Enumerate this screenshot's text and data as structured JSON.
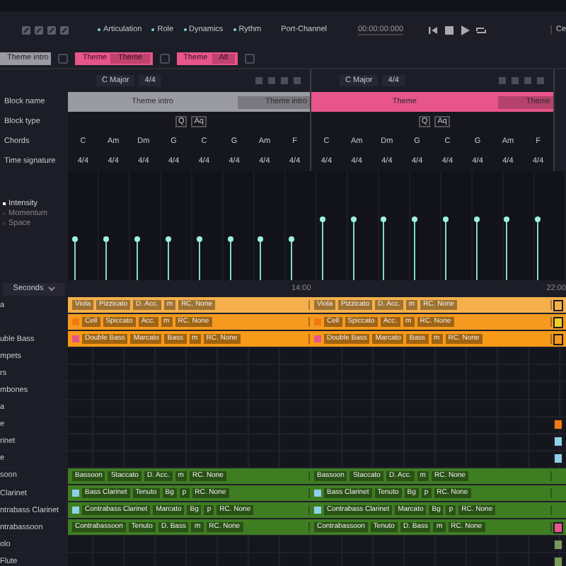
{
  "toolbar": {
    "legend": [
      {
        "label": "Articulation"
      },
      {
        "label": "Role"
      },
      {
        "label": "Dynamics"
      },
      {
        "label": "Rythm"
      }
    ],
    "port": "Port-Channel",
    "time": "00:00:00:000",
    "cut_label": "Ce"
  },
  "palette": [
    {
      "label": "Theme intro",
      "color": "#9a9aa2"
    },
    {
      "label": "Theme",
      "tag": "Theme",
      "color": "#e8558a"
    },
    {
      "label": "Theme",
      "tag": "Alt",
      "color": "#e8558a"
    }
  ],
  "row_labels": [
    "Block name",
    "Block type",
    "Chords",
    "Time signature"
  ],
  "blocks": [
    {
      "key": "C Major",
      "meter": "4/4",
      "name": "Theme intro",
      "tag": "Theme intro",
      "color": "#9a9aa2",
      "types": [
        "Q",
        "Aq"
      ],
      "chords": [
        "C",
        "Am",
        "Dm",
        "G",
        "C",
        "G",
        "Am",
        "F"
      ],
      "signatures": [
        "4/4",
        "4/4",
        "4/4",
        "4/4",
        "4/4",
        "4/4",
        "4/4",
        "4/4"
      ]
    },
    {
      "key": "C Major",
      "meter": "4/4",
      "name": "Theme",
      "tag": "Theme",
      "color": "#e8558a",
      "types": [
        "Q",
        "Aq"
      ],
      "chords": [
        "C",
        "Am",
        "Dm",
        "G",
        "C",
        "G",
        "Am",
        "F"
      ],
      "signatures": [
        "4/4",
        "4/4",
        "4/4",
        "4/4",
        "4/4",
        "4/4",
        "4/4",
        "4/4"
      ]
    }
  ],
  "curves": [
    {
      "label": "Intensity",
      "selected": true
    },
    {
      "label": "Momentum",
      "selected": false
    },
    {
      "label": "Space",
      "selected": false
    }
  ],
  "timeline": {
    "unit": "Seconds",
    "marks": [
      "14:00",
      "22:00"
    ]
  },
  "tracks": [
    {
      "label": "a",
      "color": "#f5b04c",
      "clips": [
        [
          "Viola",
          "Pizzicato",
          "D. Acc.",
          "m",
          "RC. None"
        ],
        [
          "Viola",
          "Pizzicato",
          "D. Acc.",
          "m",
          "RC. None"
        ]
      ],
      "edge": {
        "color": "#f5b04c"
      }
    },
    {
      "color": "#f59a1f",
      "marker": {
        "color": "#f07a10"
      },
      "clips": [
        [
          "Cell",
          "Spiccato",
          "Acc.",
          "m",
          "RC. None"
        ],
        [
          "Cell",
          "Spiccato",
          "Acc.",
          "m",
          "RC. None"
        ]
      ],
      "edge": {
        "color": "#f0d020"
      }
    },
    {
      "label": "uble Bass",
      "color": "#f79a18",
      "marker": {
        "color": "#e8558a"
      },
      "clips": [
        [
          "Double Bass",
          "Marcato",
          "Bass",
          "m",
          "RC. None"
        ],
        [
          "Double Bass",
          "Marcato",
          "Bass",
          "m",
          "RC. None"
        ]
      ],
      "edge": {
        "color": "#f79a18"
      }
    },
    {
      "label": "mpets"
    },
    {
      "label": "rs"
    },
    {
      "label": "mbones"
    },
    {
      "label": "a"
    },
    {
      "label": "e",
      "edge": {
        "color": "#f07a10"
      }
    },
    {
      "label": "rinet",
      "edge": {
        "color": "#8fd0e8"
      }
    },
    {
      "label": "e",
      "edge": {
        "color": "#8fd0e8"
      }
    },
    {
      "label": "soon",
      "color": "#3f7d22",
      "clips": [
        [
          "Bassoon",
          "Staccato",
          "D. Acc.",
          "m",
          "RC. None"
        ],
        [
          "Bassoon",
          "Staccato",
          "D. Acc.",
          "m",
          "RC. None"
        ]
      ]
    },
    {
      "label": "Clarinet",
      "color": "#3f7d22",
      "marker": {
        "color": "#8fd0e8"
      },
      "clips": [
        [
          "Bass Clarinet",
          "Tenuto",
          "Bg",
          "p",
          "RC. None"
        ],
        [
          "Bass Clarinet",
          "Tenuto",
          "Bg",
          "p",
          "RC. None"
        ]
      ]
    },
    {
      "label": "ntrabass Clarinet",
      "color": "#3f7d22",
      "marker": {
        "color": "#8fd0e8"
      },
      "clips": [
        [
          "Contrabass Clarinet",
          "Marcato",
          "Bg",
          "p",
          "RC. None"
        ],
        [
          "Contrabass Clarinet",
          "Marcato",
          "Bg",
          "p",
          "RC. None"
        ]
      ]
    },
    {
      "label": "ntrabassoon",
      "color": "#3f7d22",
      "clips": [
        [
          "Contrabassoon",
          "Tenuto",
          "D. Bass",
          "m",
          "RC. None"
        ],
        [
          "Contrabassoon",
          "Tenuto",
          "D. Bass",
          "m",
          "RC. None"
        ]
      ],
      "edge": {
        "color": "#e8558a"
      }
    },
    {
      "label": "olo",
      "edge": {
        "color": "#7a9a5a"
      }
    },
    {
      "label": "Flute",
      "edge": {
        "color": "#7a9a5a"
      }
    }
  ]
}
